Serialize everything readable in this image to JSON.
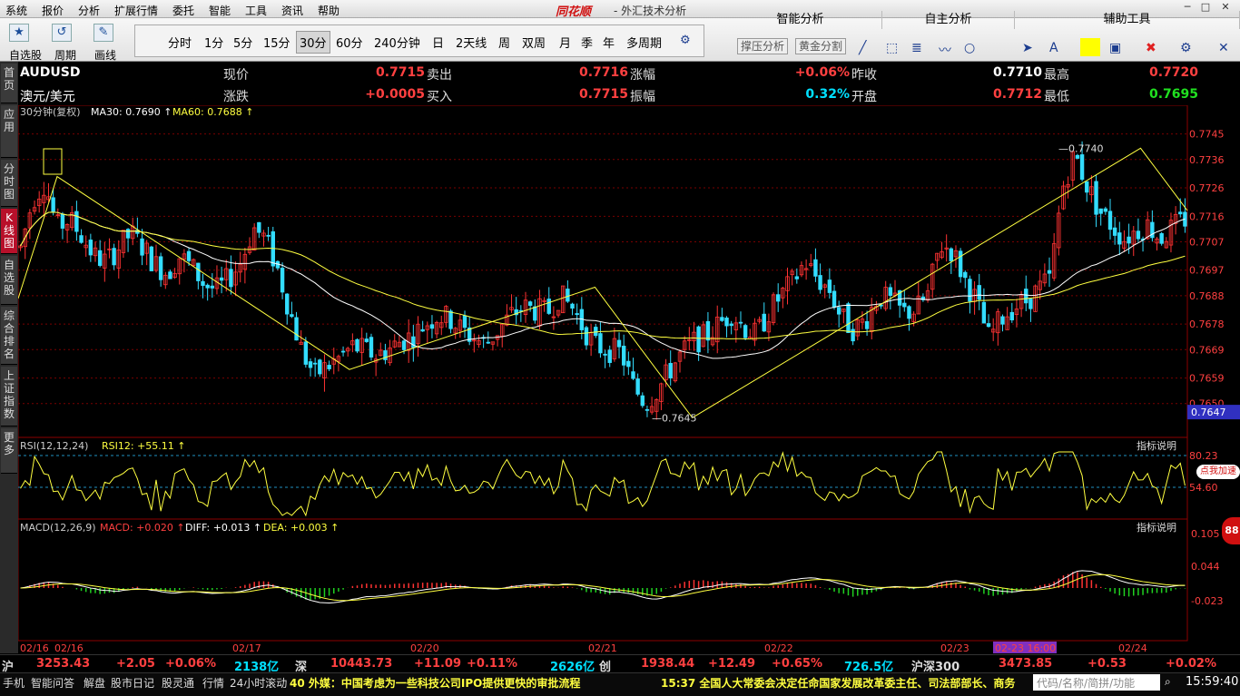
{
  "menu": [
    "系统",
    "报价",
    "分析",
    "扩展行情",
    "委托",
    "智能",
    "工具",
    "资讯",
    "帮助"
  ],
  "brand": "同花顺",
  "title": "- 外汇技术分析",
  "right_tabs": {
    "smart": "智能分析",
    "self": "自主分析",
    "aux": "辅助工具"
  },
  "right_buttons": {
    "pressure": "撑压分析",
    "golden": "黄金分割"
  },
  "left_tools": [
    {
      "icon": "★",
      "label": "自选股"
    },
    {
      "icon": "↺",
      "label": "周期"
    },
    {
      "icon": "✎",
      "label": "画线"
    }
  ],
  "periods": [
    "分时",
    "1分",
    "5分",
    "15分",
    "30分",
    "60分",
    "240分钟",
    "日",
    "2天线",
    "周",
    "双周",
    "月",
    "季",
    "年",
    "多周期"
  ],
  "active_period": "30分",
  "side_tabs": [
    "首页",
    "应用",
    "分时图",
    "K线图",
    "自选股",
    "综合排名",
    "上证指数",
    "更多"
  ],
  "quote": {
    "code": "AUDUSD",
    "name": "澳元/美元",
    "row1": [
      {
        "l": "现价",
        "v": "0.7715",
        "c": "#ff4040"
      },
      {
        "l": "卖出",
        "v": "0.7716",
        "c": "#ff4040"
      },
      {
        "l": "涨幅",
        "v": "+0.06%",
        "c": "#ff4040"
      },
      {
        "l": "昨收",
        "v": "0.7710",
        "c": "#ffffff"
      },
      {
        "l": "最高",
        "v": "0.7720",
        "c": "#ff4040"
      }
    ],
    "row2": [
      {
        "l": "涨跌",
        "v": "+0.0005",
        "c": "#ff4040"
      },
      {
        "l": "买入",
        "v": "0.7715",
        "c": "#ff4040"
      },
      {
        "l": "振幅",
        "v": "0.32%",
        "c": "#00e0ff"
      },
      {
        "l": "开盘",
        "v": "0.7712",
        "c": "#ff4040"
      },
      {
        "l": "最低",
        "v": "0.7695",
        "c": "#20e020"
      }
    ]
  },
  "ma_line": {
    "period": "30分钟(复权)",
    "ma30": "MA30: 0.7690",
    "ma60": "MA60: 0.7688"
  },
  "chart_data": {
    "type": "candlestick",
    "price_axis": [
      "0.7745",
      "0.7736",
      "0.7726",
      "0.7716",
      "0.7707",
      "0.7697",
      "0.7688",
      "0.7678",
      "0.7669",
      "0.7659",
      "0.7650"
    ],
    "price_range": [
      0.764,
      0.775
    ],
    "current_price": "0.7647",
    "high_label": "0.7740",
    "low_label": "0.7645",
    "close_path": [
      0.7705,
      0.7722,
      0.7728,
      0.7712,
      0.7715,
      0.7709,
      0.7702,
      0.77,
      0.7705,
      0.771,
      0.7705,
      0.7699,
      0.7696,
      0.7702,
      0.7698,
      0.7692,
      0.769,
      0.7694,
      0.77,
      0.7712,
      0.7708,
      0.7697,
      0.7682,
      0.7668,
      0.766,
      0.7663,
      0.7666,
      0.767,
      0.7669,
      0.7667,
      0.7669,
      0.7672,
      0.7674,
      0.7678,
      0.7681,
      0.768,
      0.7676,
      0.7673,
      0.7671,
      0.7676,
      0.7681,
      0.7684,
      0.7683,
      0.7682,
      0.7688,
      0.7684,
      0.7676,
      0.767,
      0.7669,
      0.7668,
      0.7656,
      0.765,
      0.7655,
      0.7662,
      0.7668,
      0.7672,
      0.7674,
      0.7678,
      0.7682,
      0.7677,
      0.7674,
      0.7682,
      0.7688,
      0.7693,
      0.77,
      0.7694,
      0.769,
      0.768,
      0.7676,
      0.768,
      0.7688,
      0.7686,
      0.7682,
      0.7683,
      0.7688,
      0.7706,
      0.7704,
      0.7694,
      0.7686,
      0.7673,
      0.768,
      0.7684,
      0.7686,
      0.769,
      0.7694,
      0.7726,
      0.7738,
      0.7727,
      0.7718,
      0.7713,
      0.7708,
      0.7711,
      0.7713,
      0.7708,
      0.7712,
      0.7715
    ],
    "date_labels": [
      "02/16",
      "02/16",
      "02/17",
      "02/20",
      "02/21",
      "02/22",
      "02/23",
      "02-23 16:00",
      "02/24"
    ],
    "rsi": {
      "label": "RSI(12,12,24)",
      "rsi12": "RSI12: +55.11",
      "axis": [
        "80.23",
        "54.60"
      ],
      "note": "指标说明"
    },
    "macd": {
      "label": "MACD(12,26,9)",
      "macd": "MACD: +0.020",
      "diff": "DIFF: +0.013",
      "dea": "DEA: +0.003",
      "axis": [
        "0.105",
        "0.044",
        "-0.023"
      ],
      "note": "指标说明"
    }
  },
  "bottom_ticker": [
    {
      "t": "沪",
      "c": "#ddd"
    },
    {
      "t": "3253.43",
      "c": "#ff4040"
    },
    {
      "t": "+2.05",
      "c": "#ff4040"
    },
    {
      "t": "+0.06%",
      "c": "#ff4040"
    },
    {
      "t": "2138亿",
      "c": "#00e0ff"
    },
    {
      "t": "深",
      "c": "#ddd"
    },
    {
      "t": "10443.73",
      "c": "#ff4040"
    },
    {
      "t": "+11.09",
      "c": "#ff4040"
    },
    {
      "t": "+0.11%",
      "c": "#ff4040"
    },
    {
      "t": "2626亿",
      "c": "#00e0ff"
    },
    {
      "t": "创",
      "c": "#ddd"
    },
    {
      "t": "1938.44",
      "c": "#ff4040"
    },
    {
      "t": "+12.49",
      "c": "#ff4040"
    },
    {
      "t": "+0.65%",
      "c": "#ff4040"
    },
    {
      "t": "726.5亿",
      "c": "#00e0ff"
    },
    {
      "t": "沪深300",
      "c": "#ddd"
    },
    {
      "t": "3473.85",
      "c": "#ff4040"
    },
    {
      "t": "+0.53",
      "c": "#ff4040"
    },
    {
      "t": "+0.02%",
      "c": "#ff4040"
    }
  ],
  "status_bar": {
    "items": [
      "手机",
      "智能问答",
      "解盘",
      "股市日记",
      "股灵通",
      "行情",
      "24小时滚动"
    ],
    "news1": "40 外媒：中国考虑为一些科技公司IPO提供更快的审批流程",
    "news2": "15:37 全国人大常委会决定任命国家发展改革委主任、司法部部长、商务",
    "search": "代码/名称/简拼/功能",
    "clock": "15:59:40"
  },
  "float_badge": "点我加速",
  "float_num": "88"
}
